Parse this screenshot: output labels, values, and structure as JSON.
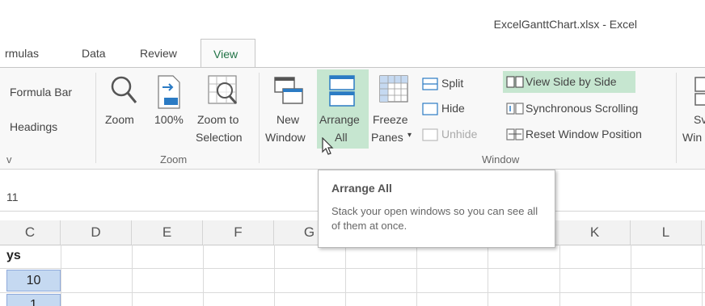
{
  "window": {
    "title": "ExcelGanttChart.xlsx - Excel"
  },
  "tabs": [
    {
      "label": "rmulas"
    },
    {
      "label": "Data"
    },
    {
      "label": "Review"
    },
    {
      "label": "View",
      "active": true
    }
  ],
  "ribbon": {
    "show": {
      "formula_bar": "Formula Bar",
      "headings": "Headings",
      "group_label": "v"
    },
    "zoom": {
      "zoom": "Zoom",
      "hundred": "100%",
      "zoom_to_1": "Zoom to",
      "zoom_to_2": "Selection",
      "group_label": "Zoom"
    },
    "window": {
      "new_1": "New",
      "new_2": "Window",
      "arrange_1": "Arrange",
      "arrange_2": "All",
      "freeze_1": "Freeze",
      "freeze_2": "Panes",
      "split": "Split",
      "hide": "Hide",
      "unhide": "Unhide",
      "view_side": "View Side by Side",
      "sync_scroll": "Synchronous Scrolling",
      "reset_pos": "Reset Window Position",
      "switch_1": "Sv",
      "switch_2": "Win",
      "group_label": "Window"
    }
  },
  "formula_bar": {
    "name_box": "11"
  },
  "grid": {
    "columns": [
      "C",
      "D",
      "E",
      "F",
      "G",
      "K",
      "L"
    ],
    "cells": {
      "c_header": "ys",
      "c_row1": "10",
      "c_row2": "1"
    }
  },
  "tooltip": {
    "title": "Arrange All",
    "body": "Stack your open windows so you can see all of them at once."
  },
  "colors": {
    "accent": "#217346",
    "highlight": "#c6e6d0",
    "selected_cell": "#c5d9f1"
  }
}
